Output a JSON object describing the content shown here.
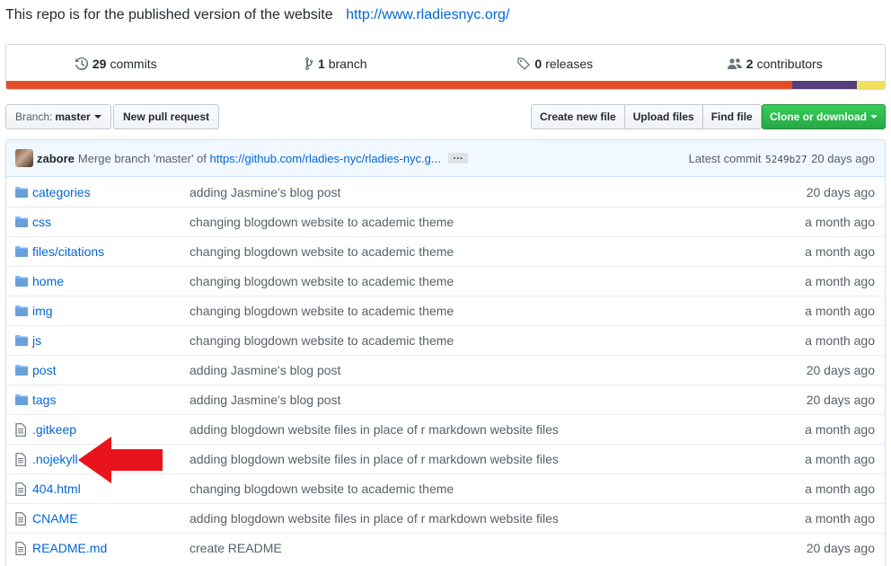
{
  "repo": {
    "description": "This repo is for the published version of the website",
    "website": "http://www.rladiesnyc.org/"
  },
  "summary": {
    "commits": {
      "count": "29",
      "label": "commits",
      "icon": "history-icon"
    },
    "branches": {
      "count": "1",
      "label": "branch",
      "icon": "branch-icon"
    },
    "releases": {
      "count": "0",
      "label": "releases",
      "icon": "tag-icon"
    },
    "contributors": {
      "count": "2",
      "label": "contributors",
      "icon": "people-icon"
    },
    "languages": [
      {
        "color": "#e34c26",
        "fraction": 0.895
      },
      {
        "color": "#563d7c",
        "fraction": 0.073
      },
      {
        "color": "#f1e05a",
        "fraction": 0.032
      }
    ]
  },
  "toolbar": {
    "branch_prefix": "Branch:",
    "branch_name": "master",
    "new_pr": "New pull request",
    "create_file": "Create new file",
    "upload_files": "Upload files",
    "find_file": "Find file",
    "clone": "Clone or download"
  },
  "commit": {
    "author": "zabore",
    "message": "Merge branch 'master' of",
    "link": "https://github.com/rladies-nyc/rladies-nyc.g...",
    "ellipsis": "…",
    "latest_label": "Latest commit",
    "sha": "5249b27",
    "age": "20 days ago"
  },
  "files": [
    {
      "type": "dir",
      "name": "categories",
      "message": "adding Jasmine's blog post",
      "age": "20 days ago"
    },
    {
      "type": "dir",
      "name": "css",
      "message": "changing blogdown website to academic theme",
      "age": "a month ago"
    },
    {
      "type": "dir",
      "name": "files/citations",
      "message": "changing blogdown website to academic theme",
      "age": "a month ago"
    },
    {
      "type": "dir",
      "name": "home",
      "message": "changing blogdown website to academic theme",
      "age": "a month ago"
    },
    {
      "type": "dir",
      "name": "img",
      "message": "changing blogdown website to academic theme",
      "age": "a month ago"
    },
    {
      "type": "dir",
      "name": "js",
      "message": "changing blogdown website to academic theme",
      "age": "a month ago"
    },
    {
      "type": "dir",
      "name": "post",
      "message": "adding Jasmine's blog post",
      "age": "20 days ago"
    },
    {
      "type": "dir",
      "name": "tags",
      "message": "adding Jasmine's blog post",
      "age": "20 days ago"
    },
    {
      "type": "file",
      "name": ".gitkeep",
      "message": "adding blogdown website files in place of r markdown website files",
      "age": "a month ago"
    },
    {
      "type": "file",
      "name": ".nojekyll",
      "message": "adding blogdown website files in place of r markdown website files",
      "age": "a month ago"
    },
    {
      "type": "file",
      "name": "404.html",
      "message": "changing blogdown website to academic theme",
      "age": "a month ago"
    },
    {
      "type": "file",
      "name": "CNAME",
      "message": "adding blogdown website files in place of r markdown website files",
      "age": "a month ago"
    },
    {
      "type": "file",
      "name": "README.md",
      "message": "create README",
      "age": "20 days ago"
    }
  ],
  "annotation": {
    "color": "#e8131b",
    "icon": "red-arrow-icon"
  }
}
